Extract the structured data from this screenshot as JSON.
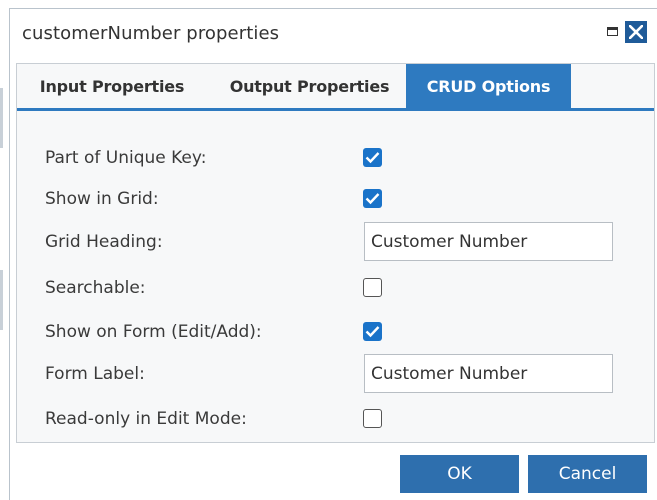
{
  "dialog": {
    "title": "customerNumber properties",
    "restore_icon": "restore-icon",
    "close_icon": "close-icon"
  },
  "tabs": [
    {
      "label": "Input Properties",
      "active": false
    },
    {
      "label": "Output Properties",
      "active": false
    },
    {
      "label": "CRUD Options",
      "active": true
    }
  ],
  "fields": {
    "part_of_unique_key": {
      "label": "Part of Unique Key:",
      "checked": true
    },
    "show_in_grid": {
      "label": "Show in Grid:",
      "checked": true
    },
    "grid_heading": {
      "label": "Grid Heading:",
      "value": "Customer Number"
    },
    "searchable": {
      "label": "Searchable:",
      "checked": false
    },
    "show_on_form": {
      "label": "Show on Form (Edit/Add):",
      "checked": true
    },
    "form_label": {
      "label": "Form Label:",
      "value": "Customer Number"
    },
    "readonly_edit": {
      "label": "Read-only in Edit Mode:",
      "checked": false
    }
  },
  "buttons": {
    "ok": "OK",
    "cancel": "Cancel"
  },
  "colors": {
    "accent": "#2e7ac0",
    "button": "#2e6fae",
    "checkbox": "#1a73c9",
    "close": "#1f5b99"
  }
}
